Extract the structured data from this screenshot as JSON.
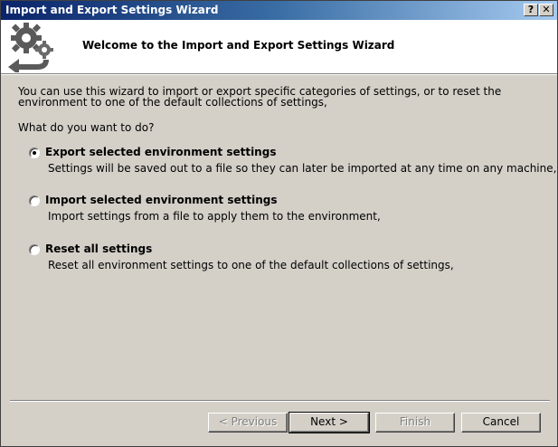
{
  "window": {
    "title": "Import and Export Settings Wizard",
    "help_label": "?",
    "close_label": "✕"
  },
  "header": {
    "title": "Welcome to the Import and Export Settings Wizard",
    "logo_icon": "gears-arrow-icon"
  },
  "body": {
    "intro_line1": "You can use this wizard to import or export specific categories of settings, or to reset the",
    "intro_line2": "environment to one of the default collections of settings,",
    "question": "What do you want to do?"
  },
  "options": [
    {
      "label": "Export selected environment settings",
      "description": "Settings will be saved out to a file so they can later be imported at any time on any machine,",
      "selected": true
    },
    {
      "label": "Import selected environment settings",
      "description": "Import settings from a file to apply them to the environment,",
      "selected": false
    },
    {
      "label": "Reset all settings",
      "description": "Reset all environment settings to one of the default collections of settings,",
      "selected": false
    }
  ],
  "buttons": {
    "previous": "< Previous",
    "next": "Next >",
    "finish": "Finish",
    "cancel": "Cancel"
  }
}
